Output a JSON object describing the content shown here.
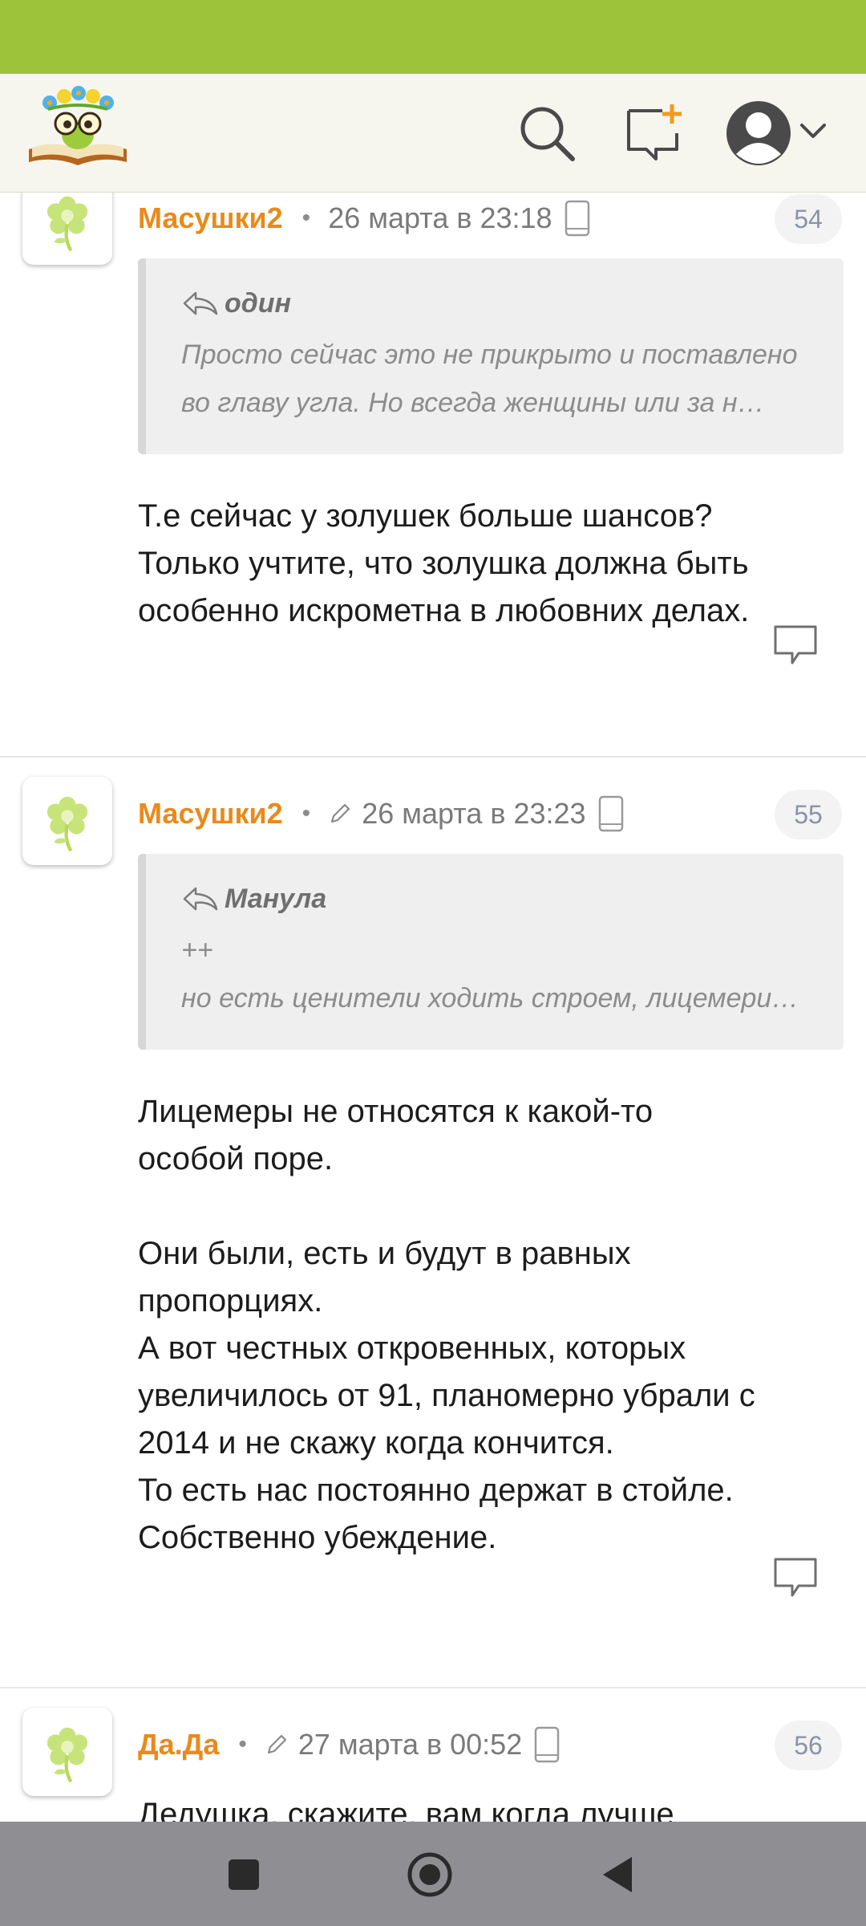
{
  "colors": {
    "status_bar": "#9dc33b",
    "accent_author": "#e98a1a",
    "notification_plus": "#f39a1e",
    "nav_bar": "#8e8e93"
  },
  "header": {
    "logo_icon": "owl-book-logo-icon",
    "search_icon": "search-icon",
    "new_post_icon": "new-message-plus-icon",
    "avatar_icon": "user-avatar-icon",
    "menu_icon": "chevron-down-icon"
  },
  "comments": [
    {
      "author": "Масушки2",
      "separator": "•",
      "date": "26 марта в 23:18",
      "edited": false,
      "number": "54",
      "quote": {
        "author": "один",
        "lines": [
          "Просто сейчас это не прикрыто и поставлено",
          "во главу угла. Но всегда женщины или за н…"
        ]
      },
      "text": "Т.е сейчас у золушек больше шансов?\nТолько учтите, что золушка должна быть\nособенно искрометна в любовних делах."
    },
    {
      "author": "Масушки2",
      "separator": "•",
      "date": "26 марта в 23:23",
      "edited": true,
      "number": "55",
      "quote": {
        "author": "Манула",
        "lines": [
          "++",
          "но есть ценители ходить строем, лицемери…"
        ]
      },
      "text": "Лицемеры не относятся к какой-то\nособой поре.\n\nОни были, есть и будут в равных\nпропорциях.\nА вот честных откровенных, которых\nувеличилось от 91, планомерно убрали с\n2014 и не скажу когда кончится.\nТо есть нас постоянно держат в стойле.\nСобственно убеждение."
    },
    {
      "author": "Да.Да",
      "separator": "•",
      "date": "27 марта в 00:52",
      "edited": true,
      "number": "56",
      "text": "Дедушка, скажите, вам когда лучше"
    }
  ],
  "nav": {
    "recent_icon": "square-recents-icon",
    "home_icon": "circle-home-icon",
    "back_icon": "triangle-back-icon"
  }
}
